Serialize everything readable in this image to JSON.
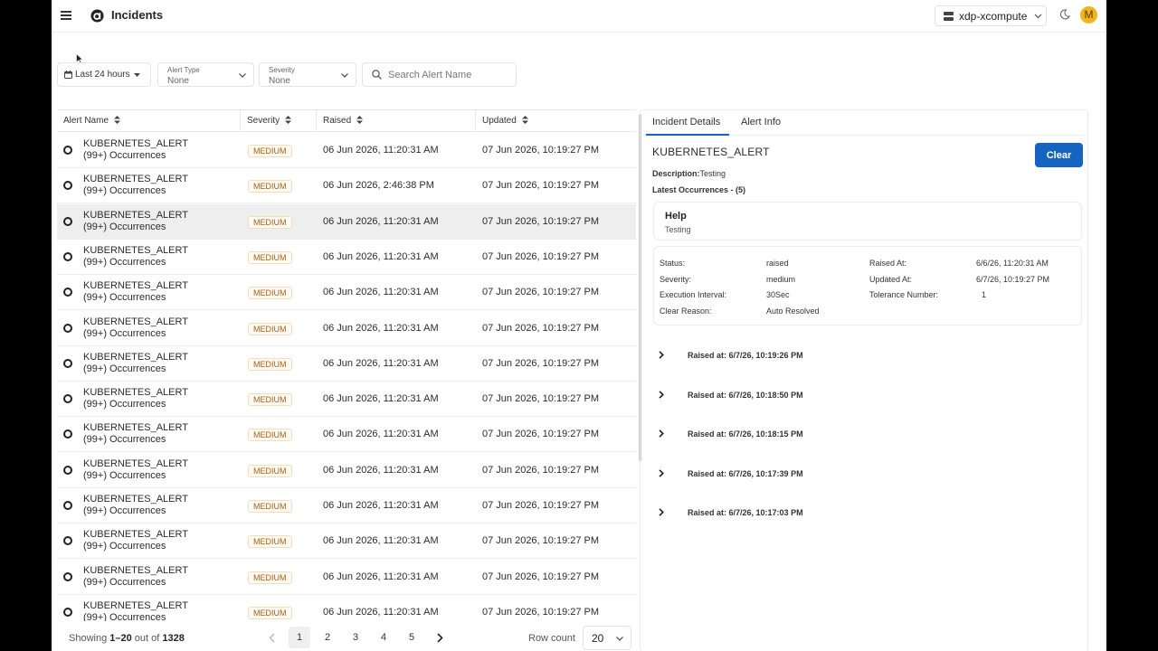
{
  "header": {
    "title": "Incidents",
    "cluster": "xdp-xcompute",
    "avatar_initial": "M"
  },
  "filters": {
    "date_range": "Last 24 hours",
    "alert_type": {
      "label": "Alert Type",
      "value": "None"
    },
    "severity": {
      "label": "Severity",
      "value": "None"
    },
    "search_placeholder": "Search Alert Name"
  },
  "table": {
    "columns": [
      "Alert Name",
      "Severity",
      "Raised",
      "Updated"
    ],
    "rows": [
      {
        "name": "KUBERNETES_ALERT",
        "occurrences": "(99+) Occurrences",
        "severity": "MEDIUM",
        "raised": "06 Jun 2026, 11:20:31 AM",
        "updated": "07 Jun 2026, 10:19:27 PM"
      },
      {
        "name": "KUBERNETES_ALERT",
        "occurrences": "(99+) Occurrences",
        "severity": "MEDIUM",
        "raised": "06 Jun 2026, 2:46:38 PM",
        "updated": "07 Jun 2026, 10:19:27 PM"
      },
      {
        "name": "KUBERNETES_ALERT",
        "occurrences": "(99+) Occurrences",
        "severity": "MEDIUM",
        "raised": "06 Jun 2026, 11:20:31 AM",
        "updated": "07 Jun 2026, 10:19:27 PM"
      },
      {
        "name": "KUBERNETES_ALERT",
        "occurrences": "(99+) Occurrences",
        "severity": "MEDIUM",
        "raised": "06 Jun 2026, 11:20:31 AM",
        "updated": "07 Jun 2026, 10:19:27 PM"
      },
      {
        "name": "KUBERNETES_ALERT",
        "occurrences": "(99+) Occurrences",
        "severity": "MEDIUM",
        "raised": "06 Jun 2026, 11:20:31 AM",
        "updated": "07 Jun 2026, 10:19:27 PM"
      },
      {
        "name": "KUBERNETES_ALERT",
        "occurrences": "(99+) Occurrences",
        "severity": "MEDIUM",
        "raised": "06 Jun 2026, 11:20:31 AM",
        "updated": "07 Jun 2026, 10:19:27 PM"
      },
      {
        "name": "KUBERNETES_ALERT",
        "occurrences": "(99+) Occurrences",
        "severity": "MEDIUM",
        "raised": "06 Jun 2026, 11:20:31 AM",
        "updated": "07 Jun 2026, 10:19:27 PM"
      },
      {
        "name": "KUBERNETES_ALERT",
        "occurrences": "(99+) Occurrences",
        "severity": "MEDIUM",
        "raised": "06 Jun 2026, 11:20:31 AM",
        "updated": "07 Jun 2026, 10:19:27 PM"
      },
      {
        "name": "KUBERNETES_ALERT",
        "occurrences": "(99+) Occurrences",
        "severity": "MEDIUM",
        "raised": "06 Jun 2026, 11:20:31 AM",
        "updated": "07 Jun 2026, 10:19:27 PM"
      },
      {
        "name": "KUBERNETES_ALERT",
        "occurrences": "(99+) Occurrences",
        "severity": "MEDIUM",
        "raised": "06 Jun 2026, 11:20:31 AM",
        "updated": "07 Jun 2026, 10:19:27 PM"
      },
      {
        "name": "KUBERNETES_ALERT",
        "occurrences": "(99+) Occurrences",
        "severity": "MEDIUM",
        "raised": "06 Jun 2026, 11:20:31 AM",
        "updated": "07 Jun 2026, 10:19:27 PM"
      },
      {
        "name": "KUBERNETES_ALERT",
        "occurrences": "(99+) Occurrences",
        "severity": "MEDIUM",
        "raised": "06 Jun 2026, 11:20:31 AM",
        "updated": "07 Jun 2026, 10:19:27 PM"
      },
      {
        "name": "KUBERNETES_ALERT",
        "occurrences": "(99+) Occurrences",
        "severity": "MEDIUM",
        "raised": "06 Jun 2026, 11:20:31 AM",
        "updated": "07 Jun 2026, 10:19:27 PM"
      },
      {
        "name": "KUBERNETES_ALERT",
        "occurrences": "(99+) Occurrences",
        "severity": "MEDIUM",
        "raised": "06 Jun 2026, 11:20:31 AM",
        "updated": "07 Jun 2026, 10:19:27 PM"
      }
    ],
    "selected_index": 2
  },
  "footer": {
    "showing_prefix": "Showing ",
    "showing_range": "1–20",
    "showing_mid": " out of ",
    "showing_total": "1328",
    "pages": [
      "1",
      "2",
      "3",
      "4",
      "5"
    ],
    "active_page": "1",
    "row_count_label": "Row count",
    "row_count": "20"
  },
  "panel": {
    "tabs": [
      "Incident Details",
      "Alert Info"
    ],
    "active_tab": "Incident Details",
    "alert_name": "KUBERNETES_ALERT",
    "clear_label": "Clear",
    "description_label": "Description:",
    "description_value": "Testing",
    "latest_occurrences": "Latest Occurrences - (5)",
    "help_title": "Help",
    "help_text": "Testing",
    "info": {
      "status_label": "Status:",
      "status": "raised",
      "severity_label": "Severity:",
      "severity": "medium",
      "exec_label": "Execution Interval:",
      "exec": "30Sec",
      "clear_reason_label": "Clear Reason:",
      "clear_reason": "Auto Resolved",
      "raised_at_label": "Raised At:",
      "raised_at": "6/6/26, 11:20:31 AM",
      "updated_at_label": "Updated At:",
      "updated_at": "6/7/26, 10:19:27 PM",
      "tolerance_label": "Tolerance Number:",
      "tolerance": "1"
    },
    "occurrences": [
      "Raised at: 6/7/26, 10:19:26 PM",
      "Raised at: 6/7/26, 10:18:50 PM",
      "Raised at: 6/7/26, 10:18:15 PM",
      "Raised at: 6/7/26, 10:17:39 PM",
      "Raised at: 6/7/26, 10:17:03 PM"
    ]
  },
  "colors": {
    "primary": "#1565c0",
    "badge_text": "#a4611a",
    "badge_border": "#f3ddbb",
    "avatar": "#f1b51c"
  }
}
